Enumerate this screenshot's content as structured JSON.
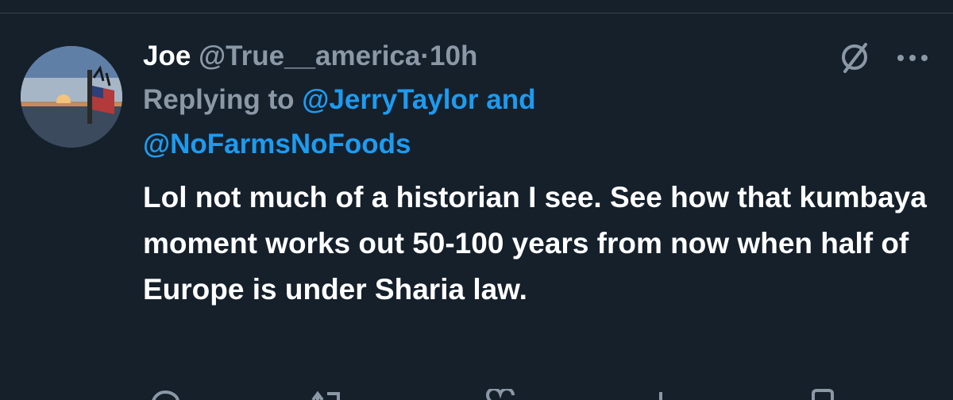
{
  "tweet": {
    "display_name": "Joe",
    "handle": "@True__america",
    "separator": "·",
    "time": "10h",
    "replying_to_label": "Replying to",
    "mentions": [
      "@JerryTaylor",
      "@NoFarmsNoFoods"
    ],
    "and_label": "and",
    "text": "Lol not much of a historian I see. See how that kumbaya moment works out 50-100 years from now when half of Europe is under Sharia law."
  },
  "icons": {
    "avatar": "profile-photo",
    "header_right": [
      "grok-icon",
      "more-options-icon"
    ],
    "actions": [
      "reply-icon",
      "retweet-icon",
      "like-icon",
      "views-icon",
      "bookmark-icon"
    ]
  },
  "colors": {
    "background": "#15202b",
    "text_primary": "#ffffff",
    "text_secondary": "#8b98a5",
    "accent": "#1d9bf0",
    "divider": "#38444d"
  }
}
